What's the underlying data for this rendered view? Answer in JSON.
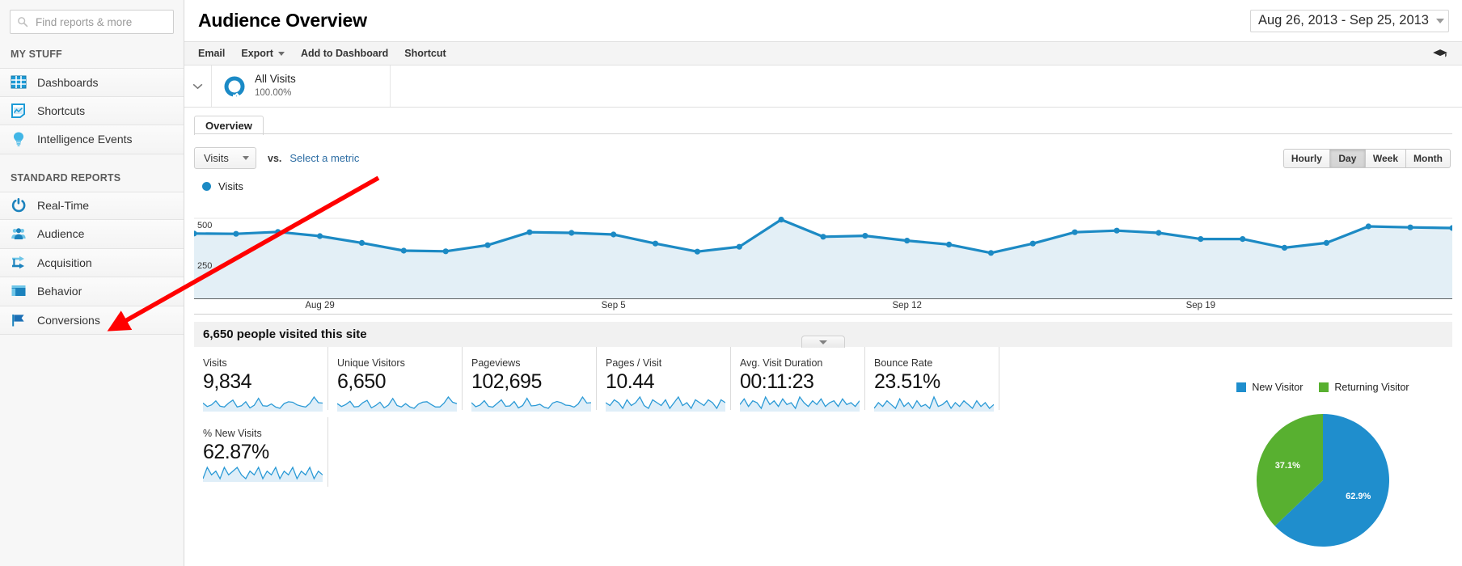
{
  "sidebar": {
    "search": {
      "placeholder": "Find reports & more",
      "value": "",
      "icon": "search-icon"
    },
    "groups": [
      {
        "heading": "MY STUFF",
        "items": [
          {
            "label": "Dashboards",
            "icon": "dashboards-icon"
          },
          {
            "label": "Shortcuts",
            "icon": "shortcuts-icon"
          },
          {
            "label": "Intelligence Events",
            "icon": "lightbulb-icon"
          }
        ]
      },
      {
        "heading": "STANDARD REPORTS",
        "items": [
          {
            "label": "Real-Time",
            "icon": "realtime-icon"
          },
          {
            "label": "Audience",
            "icon": "audience-people-icon"
          },
          {
            "label": "Acquisition",
            "icon": "acquisition-arrow-icon"
          },
          {
            "label": "Behavior",
            "icon": "behavior-layout-icon"
          },
          {
            "label": "Conversions",
            "icon": "conversions-flag-icon"
          }
        ]
      }
    ]
  },
  "header": {
    "title": "Audience Overview",
    "date_range": "Aug 26, 2013 - Sep 25, 2013",
    "date_caret_icon": "chevron-down-icon"
  },
  "actionbar": {
    "items": [
      {
        "label": "Email",
        "has_caret": false
      },
      {
        "label": "Export",
        "has_caret": true
      },
      {
        "label": "Add to Dashboard",
        "has_caret": false
      },
      {
        "label": "Shortcut",
        "has_caret": false
      }
    ],
    "help_icon": "graduation-cap-icon"
  },
  "segment": {
    "expand_icon": "chevron-down-icon",
    "donut_icon": "segment-donut-icon",
    "name": "All Visits",
    "percent": "100.00%"
  },
  "tabs": [
    {
      "label": "Overview",
      "active": true
    }
  ],
  "metric_controls": {
    "primary_metric": "Visits",
    "primary_caret_icon": "chevron-down-icon",
    "vs_label": "vs.",
    "secondary_metric_link": "Select a metric",
    "granularity": [
      {
        "label": "Hourly",
        "active": false
      },
      {
        "label": "Day",
        "active": true
      },
      {
        "label": "Week",
        "active": false
      },
      {
        "label": "Month",
        "active": false
      }
    ]
  },
  "chart_legend": {
    "label": "Visits",
    "color": "#1c8ac4"
  },
  "collapse_handle_icon": "triangle-down-icon",
  "summary": {
    "text": "6,650 people visited this site"
  },
  "metric_cards": [
    {
      "label": "Visits",
      "value": "9,834"
    },
    {
      "label": "Unique Visitors",
      "value": "6,650"
    },
    {
      "label": "Pageviews",
      "value": "102,695"
    },
    {
      "label": "Pages / Visit",
      "value": "10.44"
    },
    {
      "label": "Avg. Visit Duration",
      "value": "00:11:23"
    },
    {
      "label": "Bounce Rate",
      "value": "23.51%"
    }
  ],
  "metric_cards_row2": [
    {
      "label": "% New Visits",
      "value": "62.87%"
    }
  ],
  "pie_panel": {
    "legend": [
      {
        "label": "New Visitor",
        "color": "#1f8ecd"
      },
      {
        "label": "Returning Visitor",
        "color": "#58b030"
      }
    ],
    "slice_labels": [
      "62.9%",
      "37.1%"
    ]
  },
  "annotation": {
    "type": "red-arrow",
    "points_to": "Behavior",
    "color": "#ff0000"
  },
  "chart_data": {
    "type": "area",
    "title": "Visits",
    "xlabel": "",
    "ylabel": "Visits",
    "ylim": [
      0,
      625
    ],
    "yticks": [
      250,
      500
    ],
    "ytick_labels": [
      "250",
      "500"
    ],
    "grid": true,
    "legend_position": "top-left",
    "series": [
      {
        "name": "Visits",
        "color": "#1c8ac4",
        "fill": "#e3eff6",
        "values": [
          406,
          404,
          416,
          390,
          348,
          300,
          296,
          334,
          414,
          410,
          400,
          344,
          294,
          324,
          492,
          386,
          392,
          362,
          338,
          286,
          344,
          414,
          424,
          410,
          372,
          372,
          318,
          348,
          450,
          444,
          440
        ]
      }
    ],
    "x": [
      "Aug 26",
      "Aug 27",
      "Aug 28",
      "Aug 29",
      "Aug 30",
      "Aug 31",
      "Sep 1",
      "Sep 2",
      "Sep 3",
      "Sep 4",
      "Sep 5",
      "Sep 6",
      "Sep 7",
      "Sep 8",
      "Sep 9",
      "Sep 10",
      "Sep 11",
      "Sep 12",
      "Sep 13",
      "Sep 14",
      "Sep 15",
      "Sep 16",
      "Sep 17",
      "Sep 18",
      "Sep 19",
      "Sep 20",
      "Sep 21",
      "Sep 22",
      "Sep 23",
      "Sep 24",
      "Sep 25"
    ],
    "xtick_labels": [
      "Aug 29",
      "Sep 5",
      "Sep 12",
      "Sep 19"
    ],
    "xtick_positions": [
      3,
      10,
      17,
      24
    ]
  },
  "pie_chart_data": {
    "type": "pie",
    "title": "",
    "labels": [
      "New Visitor",
      "Returning Visitor"
    ],
    "values": [
      62.9,
      37.1
    ],
    "display_values": [
      "62.9%",
      "37.1%"
    ],
    "colors": [
      "#1f8ecd",
      "#58b030"
    ],
    "legend_position": "top"
  },
  "sparkline_data": [
    {
      "metric": "Visits",
      "values": [
        58,
        42,
        50,
        68,
        44,
        40,
        58,
        72,
        40,
        46,
        64,
        36,
        48,
        80,
        46,
        44,
        54,
        40,
        34,
        56,
        64,
        62,
        50,
        44,
        40,
        56,
        86,
        60,
        58
      ]
    },
    {
      "metric": "Unique Visitors",
      "values": [
        56,
        44,
        52,
        66,
        42,
        44,
        60,
        70,
        38,
        48,
        62,
        38,
        50,
        78,
        48,
        42,
        56,
        42,
        36,
        54,
        62,
        64,
        52,
        42,
        42,
        58,
        84,
        62,
        56
      ]
    },
    {
      "metric": "Pageviews",
      "values": [
        60,
        40,
        48,
        70,
        42,
        38,
        56,
        74,
        42,
        44,
        66,
        34,
        46,
        82,
        44,
        46,
        52,
        38,
        32,
        58,
        66,
        60,
        48,
        46,
        38,
        54,
        88,
        58,
        60
      ]
    },
    {
      "metric": "Pages / Visit",
      "values": [
        50,
        48,
        52,
        50,
        46,
        52,
        48,
        50,
        54,
        48,
        46,
        52,
        50,
        48,
        52,
        46,
        50,
        54,
        48,
        50,
        46,
        52,
        50,
        48,
        52,
        50,
        46,
        52,
        50
      ]
    },
    {
      "metric": "Avg. Visit Duration",
      "values": [
        48,
        54,
        46,
        52,
        50,
        44,
        56,
        48,
        52,
        46,
        54,
        48,
        50,
        44,
        56,
        50,
        46,
        52,
        48,
        54,
        46,
        50,
        52,
        46,
        54,
        48,
        50,
        46,
        52
      ]
    },
    {
      "metric": "Bounce Rate",
      "values": [
        44,
        50,
        46,
        52,
        48,
        44,
        54,
        46,
        50,
        44,
        52,
        46,
        48,
        44,
        56,
        46,
        48,
        52,
        44,
        50,
        46,
        52,
        48,
        44,
        52,
        46,
        50,
        44,
        48
      ]
    },
    {
      "metric": "% New Visits",
      "values": [
        46,
        52,
        48,
        50,
        46,
        52,
        48,
        50,
        52,
        48,
        46,
        50,
        48,
        52,
        46,
        50,
        48,
        52,
        46,
        50,
        48,
        52,
        46,
        50,
        48,
        52,
        46,
        50,
        48
      ]
    }
  ]
}
